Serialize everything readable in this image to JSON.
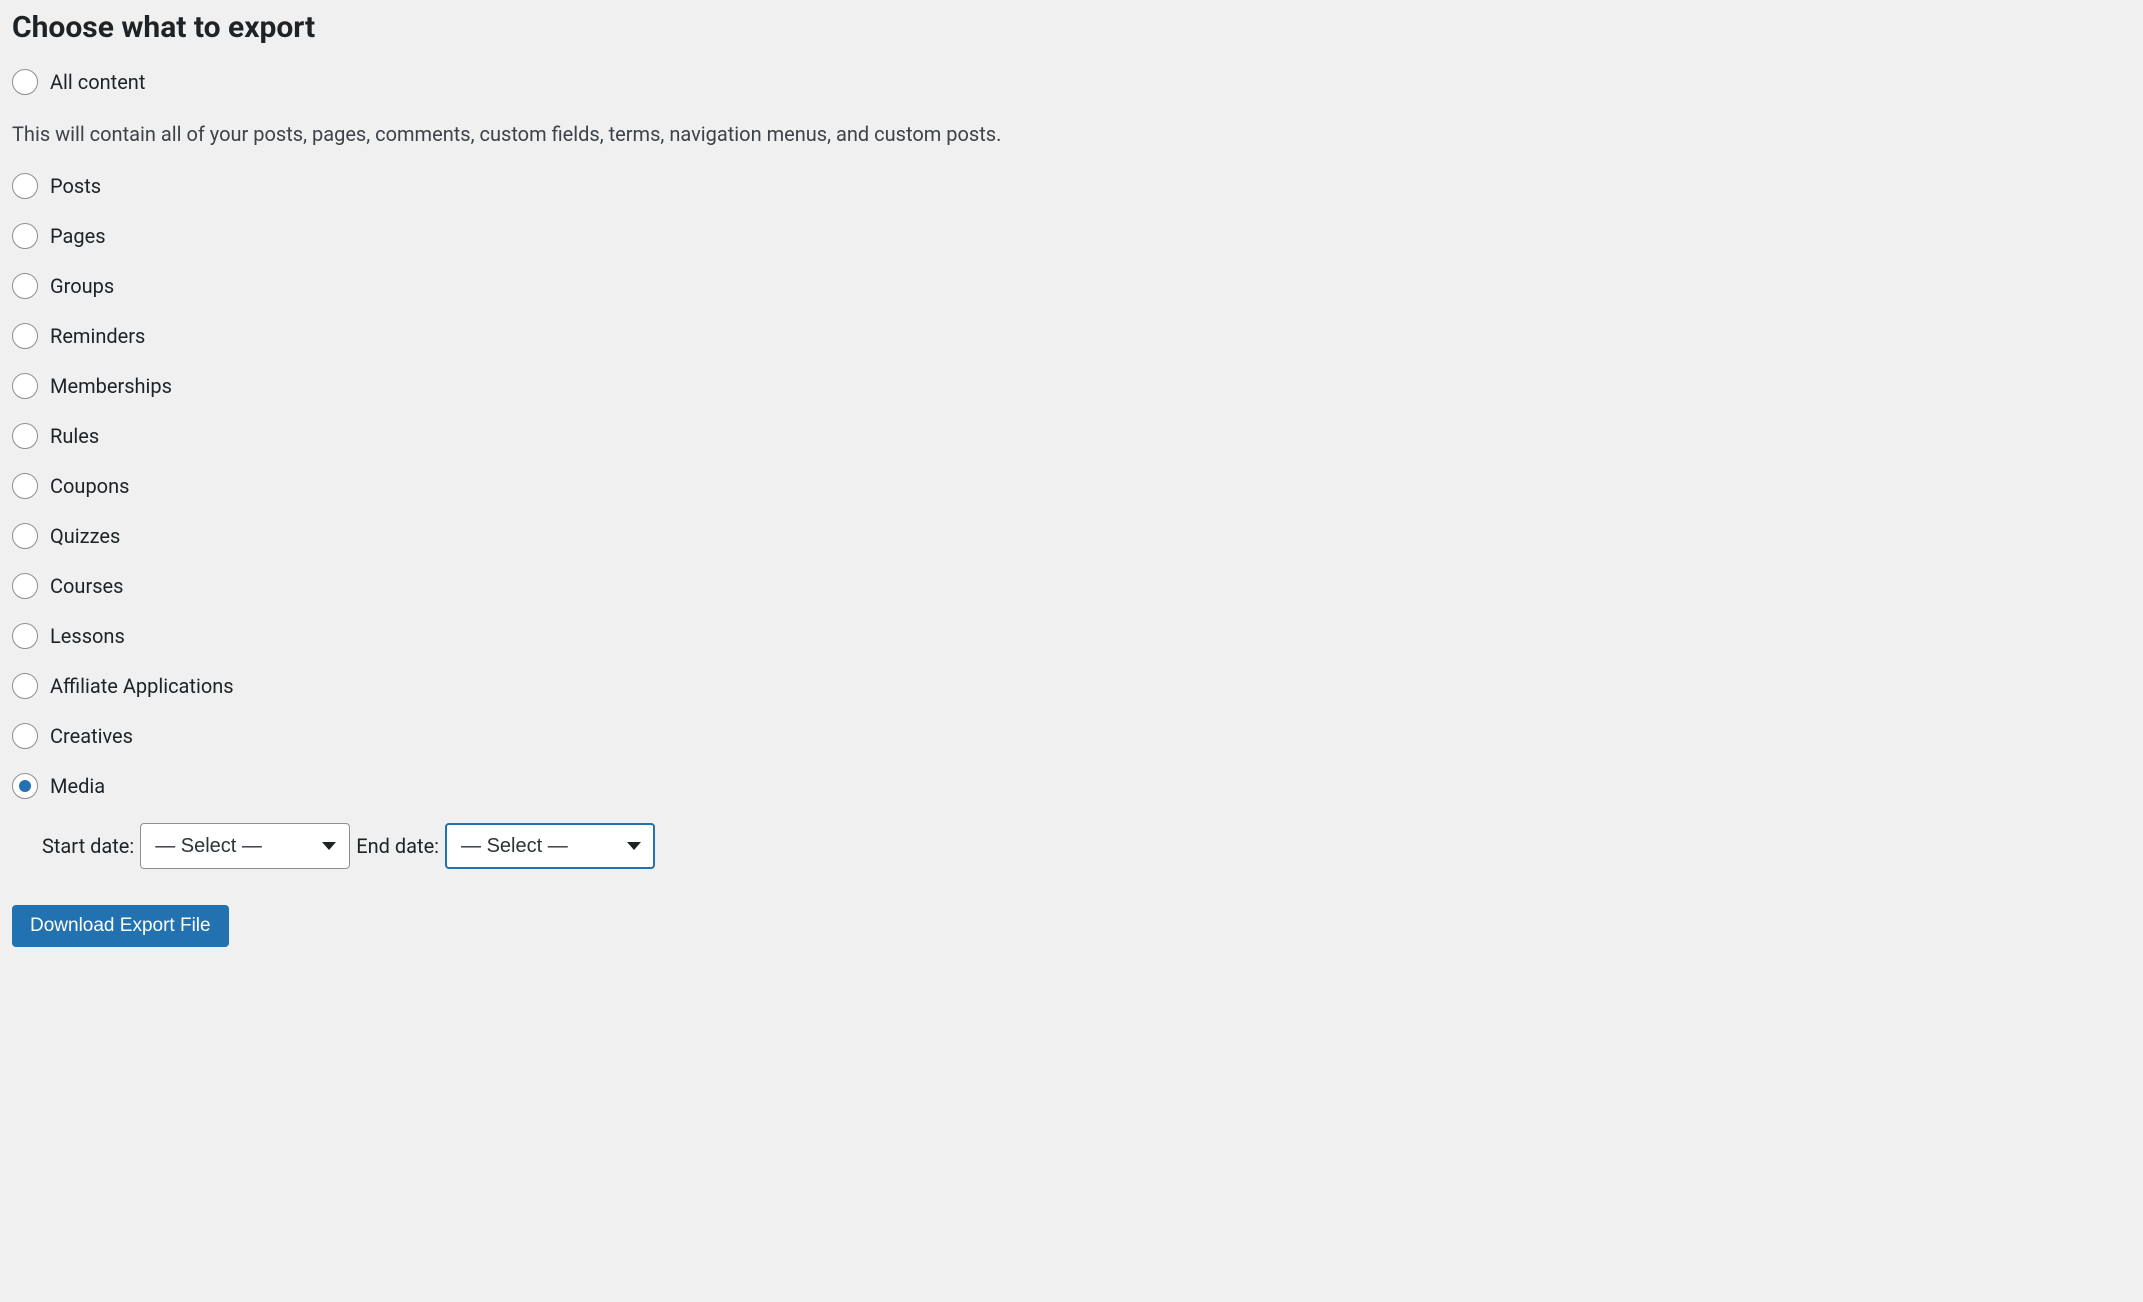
{
  "heading": "Choose what to export",
  "description": "This will contain all of your posts, pages, comments, custom fields, terms, navigation menus, and custom posts.",
  "options": {
    "all_content": "All content",
    "posts": "Posts",
    "pages": "Pages",
    "groups": "Groups",
    "reminders": "Reminders",
    "memberships": "Memberships",
    "rules": "Rules",
    "coupons": "Coupons",
    "quizzes": "Quizzes",
    "courses": "Courses",
    "lessons": "Lessons",
    "affiliate_applications": "Affiliate Applications",
    "creatives": "Creatives",
    "media": "Media"
  },
  "date_filter": {
    "start_label": "Start date:",
    "end_label": "End date:",
    "start_value": "— Select —",
    "end_value": "— Select —"
  },
  "submit_label": "Download Export File"
}
